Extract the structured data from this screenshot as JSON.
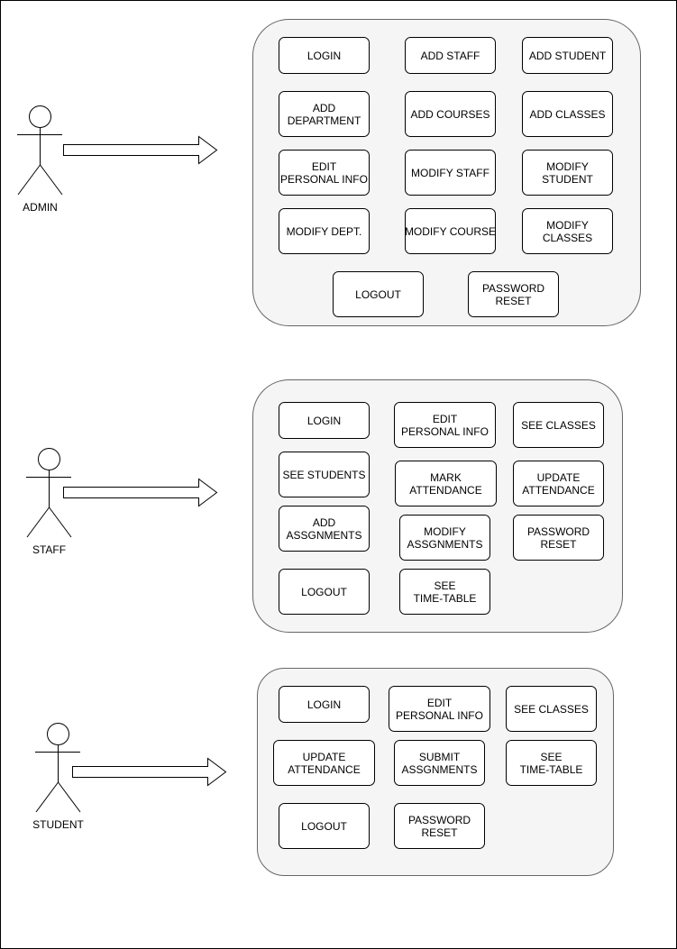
{
  "colors": {
    "container_fill": "#f5f5f5",
    "container_stroke": "#666666",
    "box_fill": "#ffffff",
    "stroke": "#000000"
  },
  "groups": [
    {
      "actor": "ADMIN",
      "actions": [
        "LOGIN",
        "ADD STAFF",
        "ADD STUDENT",
        "ADD DEPARTMENT",
        "ADD COURSES",
        "ADD CLASSES",
        "EDIT PERSONAL INFO",
        "MODIFY STAFF",
        "MODIFY STUDENT",
        "MODIFY DEPT.",
        "MODIFY COURSE",
        "MODIFY CLASSES",
        "LOGOUT",
        "PASSWORD RESET"
      ]
    },
    {
      "actor": "STAFF",
      "actions": [
        "LOGIN",
        "EDIT PERSONAL INFO",
        "SEE CLASSES",
        "SEE STUDENTS",
        "MARK ATTENDANCE",
        "UPDATE ATTENDANCE",
        "ADD ASSGNMENTS",
        "MODIFY ASSGNMENTS",
        "PASSWORD RESET",
        "LOGOUT",
        "SEE TIME-TABLE"
      ]
    },
    {
      "actor": "STUDENT",
      "actions": [
        "LOGIN",
        "EDIT PERSONAL INFO",
        "SEE CLASSES",
        "UPDATE ATTENDANCE",
        "SUBMIT ASSGNMENTS",
        "SEE TIME-TABLE",
        "LOGOUT",
        "PASSWORD RESET"
      ]
    }
  ]
}
